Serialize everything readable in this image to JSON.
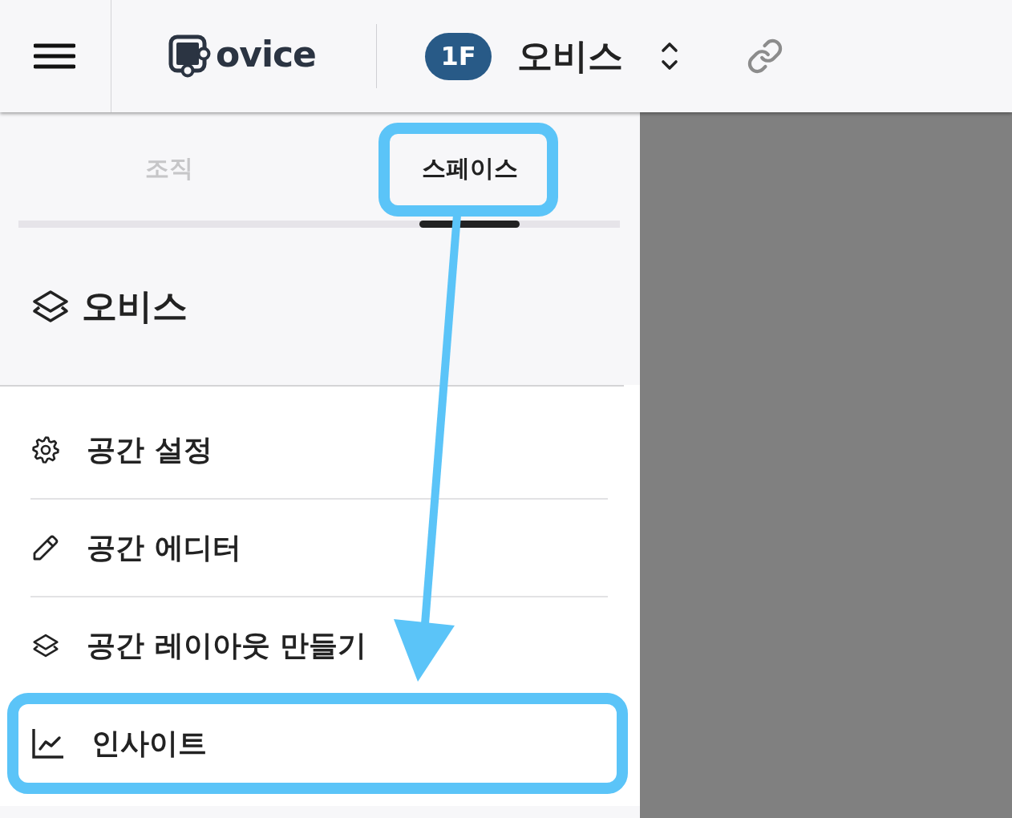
{
  "header": {
    "logo": "ovice",
    "floor_badge": "1F",
    "space_name": "오비스"
  },
  "tabs": [
    {
      "label": "조직",
      "selected": false,
      "highlighted": false
    },
    {
      "label": "스페이스",
      "selected": true,
      "highlighted": true
    }
  ],
  "space": {
    "title": "오비스"
  },
  "menu": [
    {
      "kind": "gear",
      "label": "공간 설정",
      "highlighted": false
    },
    {
      "kind": "pencil",
      "label": "공간 에디터",
      "highlighted": false
    },
    {
      "kind": "layers",
      "label": "공간 레이아웃 만들기",
      "highlighted": false
    },
    {
      "kind": "chart",
      "label": "인사이트",
      "highlighted": true
    }
  ]
}
